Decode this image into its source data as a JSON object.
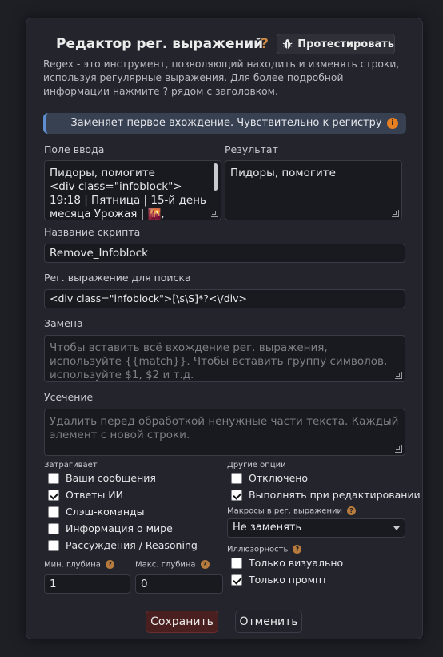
{
  "dialog": {
    "title": "Редактор рег. выражений",
    "help_mark": "?",
    "test_button": "Протестировать",
    "description": "Regex - это инструмент, позволяющий находить и изменять строки, используя регулярные выражения. Для более подробной информации нажмите ? рядом с заголовком.",
    "info_bar": "Заменяет первое вхождение. Чувствительно к регистру",
    "info_icon": "i"
  },
  "input_field": {
    "label": "Поле ввода",
    "lines": [
      "Пидоры, помогите",
      "<div class=\"infoblock\">",
      "19:18 | Пятница | 15-й день",
      "месяца Урожая | 🌇,"
    ]
  },
  "result_field": {
    "label": "Результат",
    "value": "Пидоры, помогите"
  },
  "script_name": {
    "label": "Название скрипта",
    "value": "Remove_Infoblock"
  },
  "find_regex": {
    "label": "Рег. выражение для поиска",
    "value": "<div class=\"infoblock\">[\\s\\S]*?<\\/div>"
  },
  "replace": {
    "label": "Замена",
    "placeholder": "Чтобы вставить всё вхождение рег. выражения, используйте {{match}}. Чтобы вставить группу символов, используйте $1, $2 и т.д."
  },
  "trim": {
    "label": "Усечение",
    "placeholder": "Удалить перед обработкой ненужные части текста. Каждый элемент с новой строки."
  },
  "affects": {
    "label": "Затрагивает",
    "items": [
      {
        "label": "Ваши сообщения",
        "checked": false
      },
      {
        "label": "Ответы ИИ",
        "checked": true
      },
      {
        "label": "Слэш-команды",
        "checked": false
      },
      {
        "label": "Информация о мире",
        "checked": false
      },
      {
        "label": "Рассуждения / Reasoning",
        "checked": false
      }
    ]
  },
  "other_options": {
    "label": "Другие опции",
    "items": [
      {
        "label": "Отключено",
        "checked": false
      },
      {
        "label": "Выполнять при редактировании",
        "checked": true
      }
    ]
  },
  "macros": {
    "label": "Макросы в рег. выражении",
    "selected": "Не заменять"
  },
  "ephemerality": {
    "label": "Иллюзорность",
    "items": [
      {
        "label": "Только визуально",
        "checked": false
      },
      {
        "label": "Только промпт",
        "checked": true
      }
    ]
  },
  "depth": {
    "min_label": "Мин. глубина",
    "min_value": "1",
    "max_label": "Макс. глубина",
    "max_value": "0"
  },
  "footer": {
    "save": "Сохранить",
    "cancel": "Отменить"
  }
}
